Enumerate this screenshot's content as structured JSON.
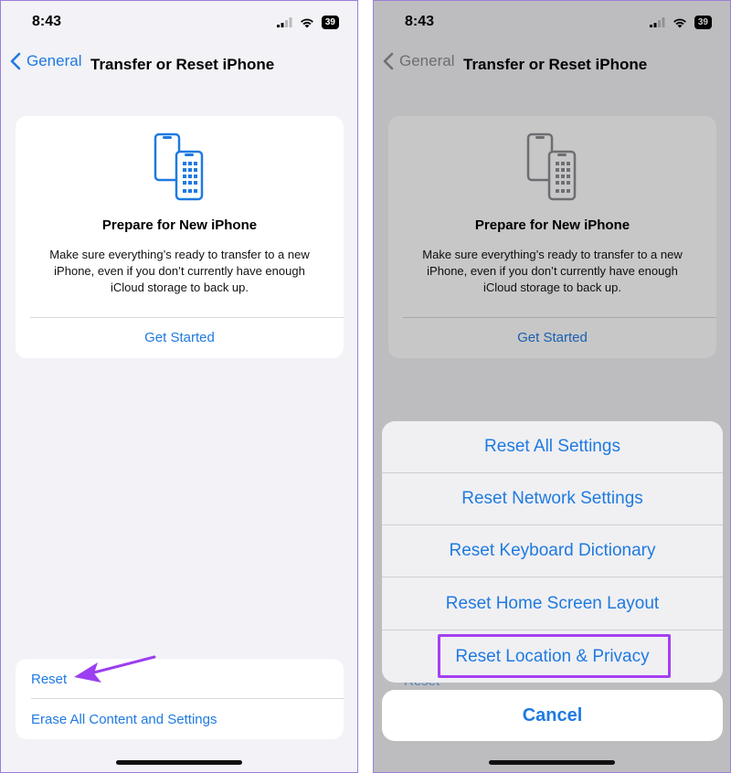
{
  "colors": {
    "accent": "#1f7ae0",
    "highlight": "#a63ff0",
    "arrow": "#9b3ff0"
  },
  "left": {
    "status": {
      "time": "8:43",
      "battery": "39"
    },
    "nav": {
      "back_label": "General",
      "title": "Transfer or Reset iPhone"
    },
    "card": {
      "title": "Prepare for New iPhone",
      "description": "Make sure everything’s ready to transfer to a new iPhone, even if you don’t currently have enough iCloud storage to back up.",
      "action": "Get Started"
    },
    "bottom": {
      "reset": "Reset",
      "erase": "Erase All Content and Settings"
    }
  },
  "right": {
    "status": {
      "time": "8:43",
      "battery": "39"
    },
    "nav": {
      "back_label": "General",
      "title": "Transfer or Reset iPhone"
    },
    "card": {
      "title": "Prepare for New iPhone",
      "description": "Make sure everything’s ready to transfer to a new iPhone, even if you don’t currently have enough iCloud storage to back up.",
      "action": "Get Started"
    },
    "sheet": {
      "options": [
        "Reset All Settings",
        "Reset Network Settings",
        "Reset Keyboard Dictionary",
        "Reset Home Screen Layout",
        "Reset Location & Privacy"
      ],
      "cancel": "Cancel",
      "under_text": "Reset"
    }
  }
}
